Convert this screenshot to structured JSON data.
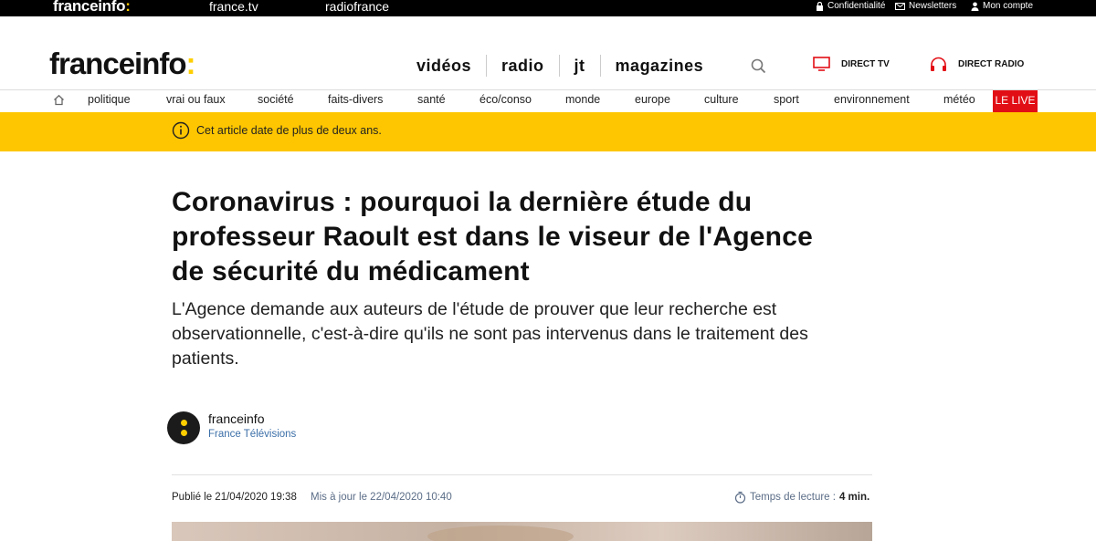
{
  "topbar": {
    "brand": "franceinfo",
    "brand_colon": ":",
    "links": [
      "france.tv",
      "radiofrance"
    ],
    "right": [
      {
        "label": "Confidentialité",
        "icon": "lock-icon"
      },
      {
        "label": "Newsletters",
        "icon": "mail-icon"
      },
      {
        "label": "Mon compte",
        "icon": "user-icon"
      }
    ]
  },
  "header": {
    "logo": "franceinfo",
    "logo_colon": ":",
    "nav": [
      "vidéos",
      "radio",
      "jt",
      "magazines"
    ],
    "direct_tv": "DIRECT TV",
    "direct_radio": "DIRECT RADIO"
  },
  "categories": [
    "politique",
    "vrai ou faux",
    "société",
    "faits-divers",
    "santé",
    "éco/conso",
    "monde",
    "europe",
    "culture",
    "sport",
    "environnement",
    "météo"
  ],
  "live_label": "LE LIVE",
  "banner": {
    "text": "Cet article date de plus de deux ans."
  },
  "article": {
    "title": "Coronavirus : pourquoi la dernière étude du professeur Raoult est dans le viseur de l'Agence de sécurité du médicament",
    "lead": "L'Agence demande aux auteurs de l'étude de prouver que leur recherche est observationnelle, c'est-à-dire qu'ils ne sont pas intervenus dans le traitement des patients.",
    "author": "franceinfo",
    "author_org": "France Télévisions",
    "published": "Publié le 21/04/2020 19:38",
    "updated": "Mis à jour le 22/04/2020 10:40",
    "reading_label": "Temps de lecture :",
    "reading_value": "4 min."
  },
  "colors": {
    "brand_yellow": "#fece00",
    "banner_yellow": "#fec600",
    "live_red": "#e20e15",
    "direct_red": "#e20e15"
  }
}
